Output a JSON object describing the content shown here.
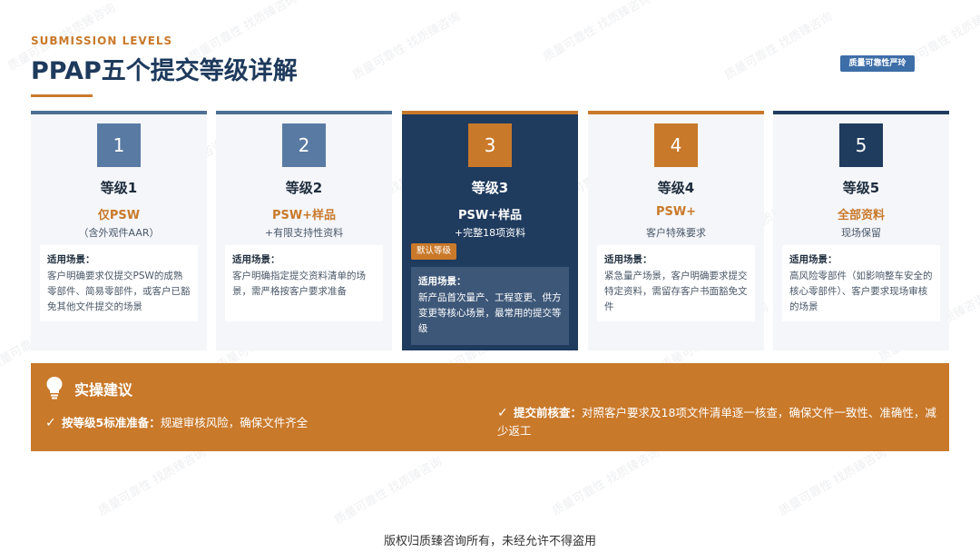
{
  "header": {
    "eyebrow": "SUBMISSION LEVELS",
    "title": "PPAP五个提交等级详解",
    "brand_badge": "质量可靠性严玲"
  },
  "cards": [
    {
      "number": "1",
      "level": "等级1",
      "requirement": "仅PSW",
      "note": "（含外观件AAR）",
      "scene_title": "适用场景：",
      "scene_text": "客户明确要求仅提交PSW的成熟零部件、简易零部件，或客户已豁免其他文件提交的场景"
    },
    {
      "number": "2",
      "level": "等级2",
      "requirement": "PSW+样品",
      "note": "+有限支持性资料",
      "scene_title": "适用场景：",
      "scene_text": "客户明确指定提交资料清单的场景，需严格按客户要求准备"
    },
    {
      "number": "3",
      "level": "等级3",
      "requirement": "PSW+样品",
      "note": "+完整18项资料",
      "tag": "默认等级",
      "scene_title": "适用场景：",
      "scene_text": "新产品首次量产、工程变更、供方变更等核心场景，最常用的提交等级"
    },
    {
      "number": "4",
      "level": "等级4",
      "requirement": "PSW+",
      "note": "客户特殊要求",
      "scene_title": "适用场景：",
      "scene_text": "紧急量产场景，客户明确要求提交特定资料，需留存客户书面豁免文件"
    },
    {
      "number": "5",
      "level": "等级5",
      "requirement": "全部资料",
      "note": "现场保留",
      "scene_title": "适用场景：",
      "scene_text": "高风险零部件（如影响整车安全的核心零部件）、客户要求现场审核的场景"
    }
  ],
  "advice": {
    "title": "实操建议",
    "tips": [
      {
        "strong": "按等级5标准准备：",
        "text": "规避审核风险，确保文件齐全"
      },
      {
        "strong": "提交前核查：",
        "text": "对照客户要求及18项文件清单逐一核查，确保文件一致性、准确性，减少返工"
      }
    ]
  },
  "footer": {
    "text": "版权归质臻咨询所有，未经允许不得盗用"
  },
  "watermark": {
    "text": "质量可靠性 找质臻咨询"
  },
  "colors": {
    "accent": "#c9792a",
    "navy": "#1f3b5e",
    "steel": "#597ba3"
  }
}
